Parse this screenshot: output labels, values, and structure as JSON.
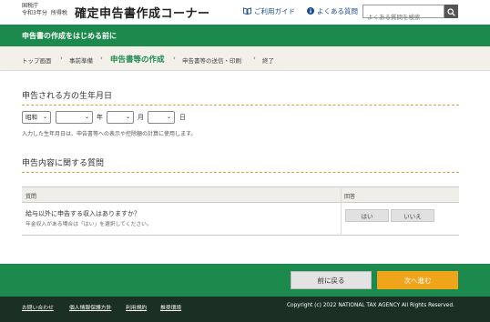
{
  "header": {
    "agency_line1": "国税庁",
    "agency_year": "令和3年分",
    "agency_version": "所得税",
    "site_title": "確定申告書作成コーナー",
    "guide_link": "ご利用ガイド",
    "faq_link": "よくある質問",
    "search_placeholder": "よくある質問を検索",
    "icons": {
      "guide": "book-icon",
      "faq": "info-circle-icon",
      "search": "search-icon"
    }
  },
  "band": {
    "title": "申告書の作成をはじめる前に"
  },
  "breadcrumb": {
    "items": [
      "トップ画面",
      "事前準備",
      "申告書等の作成",
      "申告書等の送信・印刷",
      "終了"
    ],
    "current_index": 2,
    "separator": "›"
  },
  "birth_section": {
    "title": "申告される方の生年月日",
    "era_value": "昭和",
    "year_value": "",
    "month_value": "",
    "day_value": "",
    "year_unit": "年",
    "month_unit": "月",
    "day_unit": "日",
    "hint": "入力した生年月日は、申告書等への表示や控除額の計算に使用します。"
  },
  "question_section": {
    "title": "申告内容に関する質問",
    "col_question": "質問",
    "col_answer": "回答",
    "question": "給与以外に申告する収入はありますか？",
    "question_note": "年金収入がある場合は「はい」を選択してください。",
    "yes_label": "はい",
    "no_label": "いいえ"
  },
  "navigation": {
    "back_label": "前に戻る",
    "next_label": "次へ進む"
  },
  "footer": {
    "links": [
      "お問い合わせ",
      "個人情報保護方針",
      "利用規約",
      "推奨環境"
    ],
    "copyright": "Copyright (c) 2022 NATIONAL TAX AGENCY All Rights Reserved."
  },
  "colors": {
    "brand_green": "#1c8a4d",
    "next_orange": "#f0a41a",
    "footer_dark": "#1b2f25",
    "rule_orange": "#e0a040"
  }
}
